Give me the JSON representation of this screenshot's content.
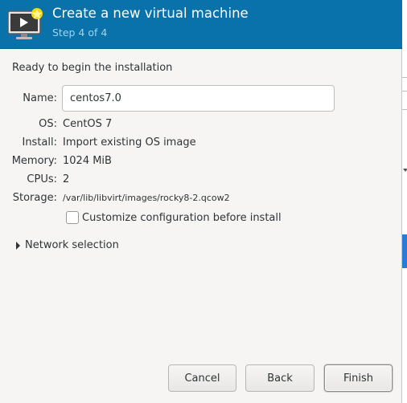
{
  "header": {
    "title": "Create a new virtual machine",
    "step": "Step 4 of 4"
  },
  "summary": {
    "heading": "Ready to begin the installation",
    "name_label": "Name:",
    "name_value": "centos7.0",
    "os_label": "OS:",
    "os_value": "CentOS 7",
    "install_label": "Install:",
    "install_value": "Import existing OS image",
    "memory_label": "Memory:",
    "memory_value": "1024 MiB",
    "cpus_label": "CPUs:",
    "cpus_value": "2",
    "storage_label": "Storage:",
    "storage_value": "/var/lib/libvirt/images/rocky8-2.qcow2"
  },
  "options": {
    "customize_label": "Customize configuration before install",
    "customize_checked": false,
    "network_label": "Network selection"
  },
  "buttons": {
    "cancel": "Cancel",
    "back": "Back",
    "finish": "Finish"
  },
  "colors": {
    "header_bg": "#0a72aa",
    "step_text": "#9fd3f2"
  }
}
